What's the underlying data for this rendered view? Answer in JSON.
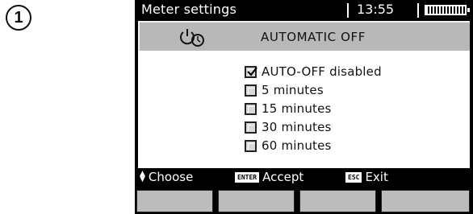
{
  "step": {
    "number": "1"
  },
  "statusbar": {
    "title": "Meter settings",
    "time": "13:55",
    "battery_icon": "battery-full-icon"
  },
  "header": {
    "icon": "timer-power-icon",
    "title": "AUTOMATIC OFF"
  },
  "options": [
    {
      "label": "AUTO-OFF disabled",
      "checked": true
    },
    {
      "label": "5 minutes",
      "checked": false
    },
    {
      "label": "15 minutes",
      "checked": false
    },
    {
      "label": "30 minutes",
      "checked": false
    },
    {
      "label": "60 minutes",
      "checked": false
    }
  ],
  "footer": {
    "choose": {
      "icon": "up-down-arrows-icon",
      "label": "Choose"
    },
    "accept": {
      "key": "ENTER",
      "label": "Accept"
    },
    "exit": {
      "key": "ESC",
      "label": "Exit"
    }
  },
  "colors": {
    "screen_bg": "#000000",
    "header_bg": "#b8b8b8",
    "panel_bg": "#ffffff",
    "softkey": "#bcbcbc"
  }
}
